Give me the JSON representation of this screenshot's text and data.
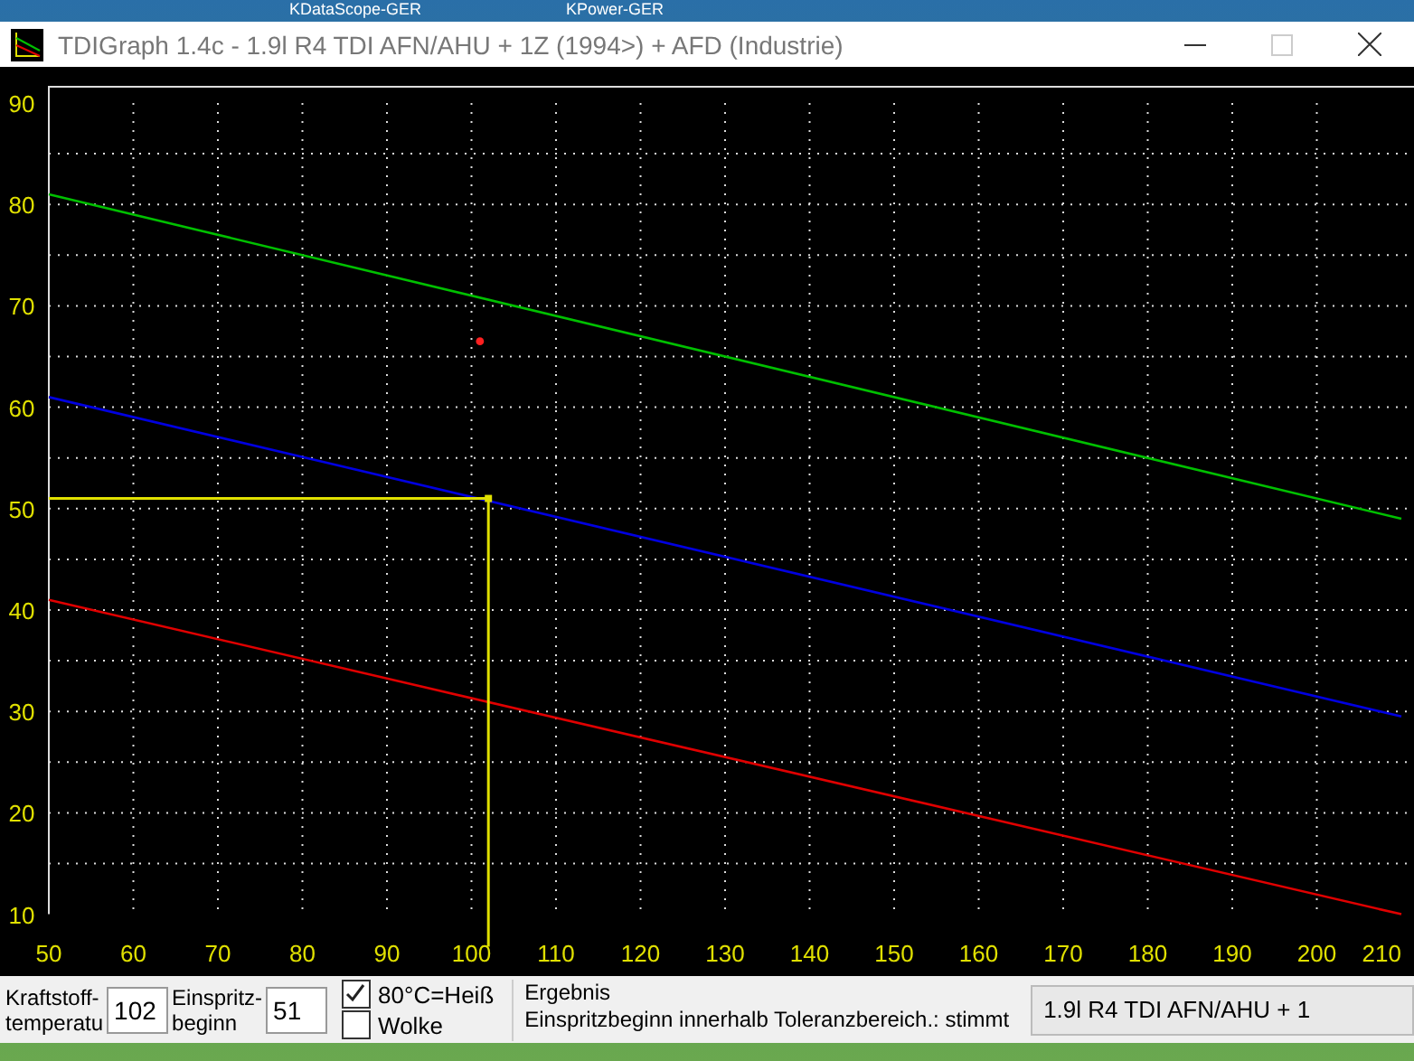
{
  "desktop": {
    "icons": [
      {
        "label": "KDataScope-GER"
      },
      {
        "label": "KPower-GER"
      }
    ]
  },
  "window": {
    "title": "TDIGraph 1.4c - 1.9l R4 TDI AFN/AHU + 1Z (1994>) + AFD (Industrie)"
  },
  "chart": {
    "chart_data": {
      "type": "line",
      "x": [
        50,
        210
      ],
      "xlim": [
        50,
        210
      ],
      "ylim": [
        10,
        90
      ],
      "xticks": [
        50,
        60,
        70,
        80,
        90,
        100,
        110,
        120,
        130,
        140,
        150,
        160,
        170,
        180,
        190,
        200,
        210
      ],
      "grid": true,
      "yticks": [
        10,
        20,
        30,
        40,
        50,
        60,
        70,
        80,
        90
      ],
      "series": [
        {
          "color": "#00c000",
          "values": [
            81,
            49
          ]
        },
        {
          "color": "#0000e0",
          "values": [
            61,
            29.5
          ]
        },
        {
          "color": "#e00000",
          "values": [
            41,
            10
          ]
        }
      ]
    }
  },
  "controls": {
    "fuel_temp": {
      "label_1": "Kraftstoff-",
      "label_2": "temperatu",
      "value": "102"
    },
    "injection": {
      "label_1": "Einspritz-",
      "label_2": "beginn",
      "value": "51"
    },
    "checkboxes": [
      {
        "label": "80°C=Heiß",
        "checked": true
      },
      {
        "label": "Wolke",
        "checked": false
      }
    ],
    "result": {
      "title": "Ergebnis",
      "text": "Einspritzbeginn innerhalb Toleranzbereich.: stimmt"
    },
    "engine_select": {
      "value": "1.9l R4 TDI AFN/AHU + 1"
    }
  }
}
